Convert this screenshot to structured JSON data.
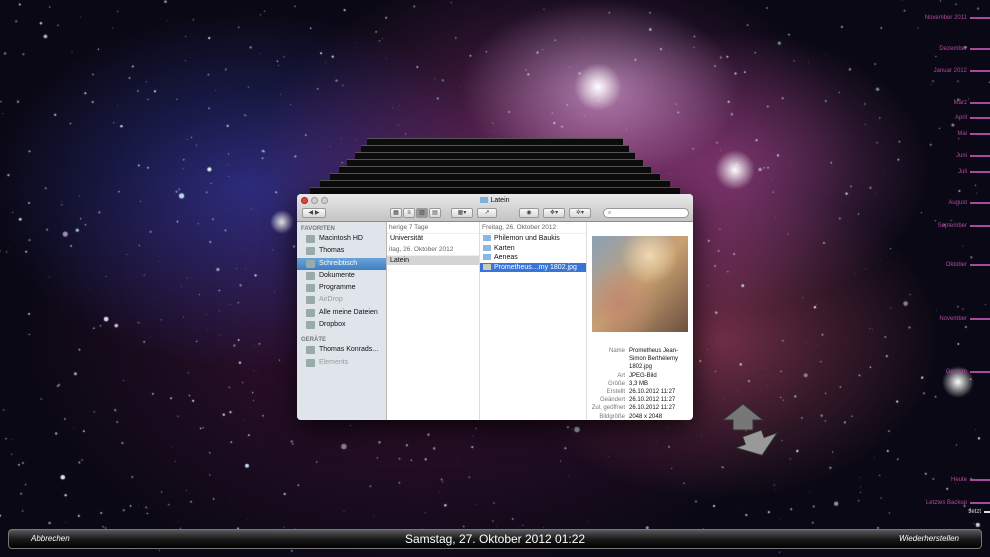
{
  "window": {
    "title": "Latein",
    "search_placeholder": ""
  },
  "sidebar": {
    "favorites_header": "FAVORITEN",
    "favorites": [
      {
        "label": "Macintosh HD"
      },
      {
        "label": "Thomas"
      },
      {
        "label": "Schreibtisch"
      },
      {
        "label": "Dokumente"
      },
      {
        "label": "Programme"
      },
      {
        "label": "AirDrop"
      },
      {
        "label": "Alle meine Dateien"
      },
      {
        "label": "Dropbox"
      }
    ],
    "devices_header": "GERÄTE",
    "devices": [
      {
        "label": "Thomas Konrads..."
      },
      {
        "label": "Elements"
      }
    ]
  },
  "column1": {
    "group1": "herige 7 Tage",
    "item1": "Universität",
    "group2": "itag, 26. Oktober 2012",
    "item2": "Latein"
  },
  "column2": {
    "group": "Freitag, 26. Oktober 2012",
    "items": [
      "Philemon und Baukis",
      "Karten",
      "Aeneas",
      "Prometheus…my 1802.jpg"
    ]
  },
  "info": [
    {
      "k": "Name",
      "v": "Prometheus Jean-Simon Berthélemy 1802.jpg"
    },
    {
      "k": "Art",
      "v": "JPEG-Bild"
    },
    {
      "k": "Größe",
      "v": "3,3 MB"
    },
    {
      "k": "Erstellt",
      "v": "26.10.2012 11:27"
    },
    {
      "k": "Geändert",
      "v": "26.10.2012 11:27"
    },
    {
      "k": "Zul. geöffnet",
      "v": "26.10.2012 11:27"
    },
    {
      "k": "Bildgröße",
      "v": "2048 x 2048"
    }
  ],
  "timeline": [
    "November 2011",
    "Dezember",
    "Januar 2012",
    "März",
    "April",
    "Mai",
    "Juni",
    "Juli",
    "August",
    "September",
    "Oktober",
    "November",
    "Gestern",
    "Heute",
    "Letztes Backup",
    "Jetzt"
  ],
  "bottom": {
    "cancel": "Abbrechen",
    "date": "Samstag, 27. Oktober 2012 01:22",
    "restore": "Wiederherstellen"
  }
}
